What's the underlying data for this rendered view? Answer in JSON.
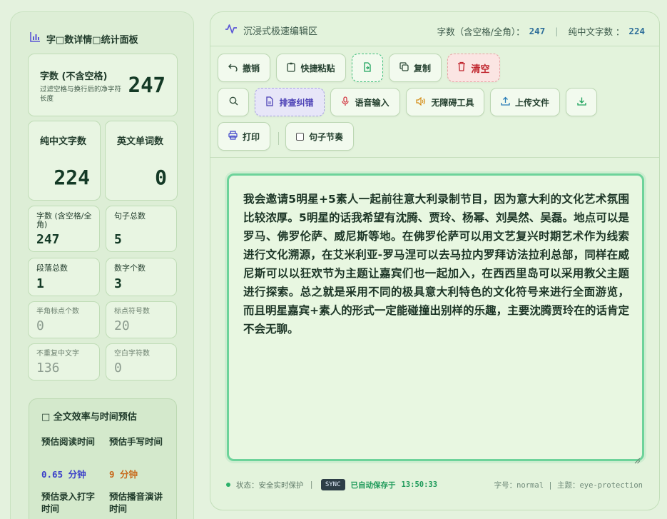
{
  "sidebar": {
    "title": "字□数详情□统计面板",
    "main_card": {
      "label": "字数 (不含空格)",
      "sub": "过滤空格与换行后的净字符长度",
      "value": "247"
    },
    "cn_card": {
      "label": "纯中文字数",
      "value": "224"
    },
    "en_card": {
      "label": "英文单词数",
      "value": "0"
    },
    "small_cards": [
      {
        "label": "字数 (含空格/全角)",
        "value": "247"
      },
      {
        "label": "句子总数",
        "value": "5"
      },
      {
        "label": "段落总数",
        "value": "1"
      },
      {
        "label": "数字个数",
        "value": "3"
      },
      {
        "label": "半角标点个数",
        "value": "0"
      },
      {
        "label": "标点符号数",
        "value": "20"
      },
      {
        "label": "不重复中文字",
        "value": "136"
      },
      {
        "label": "空白字符数",
        "value": "0"
      }
    ],
    "efficiency": {
      "title": "□ 全文效率与时间预估",
      "read_label": "预估阅读时间",
      "read_value": "0.65 分钟",
      "write_label": "预估手写时间",
      "write_value": "9 分钟",
      "type_label": "预估录入打字时间",
      "speech_label": "预估播音演讲时间"
    }
  },
  "header": {
    "brand": "沉浸式极速编辑区",
    "stat1_label": "字数（含空格/全角）：",
    "stat1_value": "247",
    "stat2_label": "纯中文字数 ：",
    "stat2_value": "224"
  },
  "toolbar": {
    "undo": "撤销",
    "paste": "快捷粘贴",
    "copy": "复制",
    "clear": "清空",
    "proofread": "排查纠错",
    "voice": "语音输入",
    "accessibility": "无障碍工具",
    "upload": "上传文件",
    "print": "打印",
    "rhythm": "句子节奏"
  },
  "editor": {
    "text": "我会邀请5明星+5素人一起前往意大利录制节目，因为意大利的文化艺术氛围比较浓厚。5明星的话我希望有沈腾、贾玲、杨幂、刘昊然、吴磊。地点可以是罗马、佛罗伦萨、威尼斯等地。在佛罗伦萨可以用文艺复兴时期艺术作为线索进行文化溯源，在艾米利亚-罗马涅可以去马拉内罗拜访法拉利总部，同样在威尼斯可以以狂欢节为主题让嘉宾们也一起加入，在西西里岛可以采用教父主题进行探索。总之就是采用不同的极具意大利特色的文化符号来进行全面游览，而且明星嘉宾+素人的形式一定能碰撞出别样的乐趣，主要沈腾贾玲在的话肯定不会无聊。"
  },
  "footer": {
    "status": "状态：安全实时保护",
    "sync": "SYNC",
    "saved": "已自动保存于",
    "time": "13:50:33",
    "size_theme": "字号：normal | 主题：eye-protection"
  },
  "colors": {
    "accent": "#6dd39a",
    "danger": "#c0262e",
    "purple": "#4a3fb5",
    "orange": "#c8691b",
    "blue": "#3a3fc9"
  }
}
